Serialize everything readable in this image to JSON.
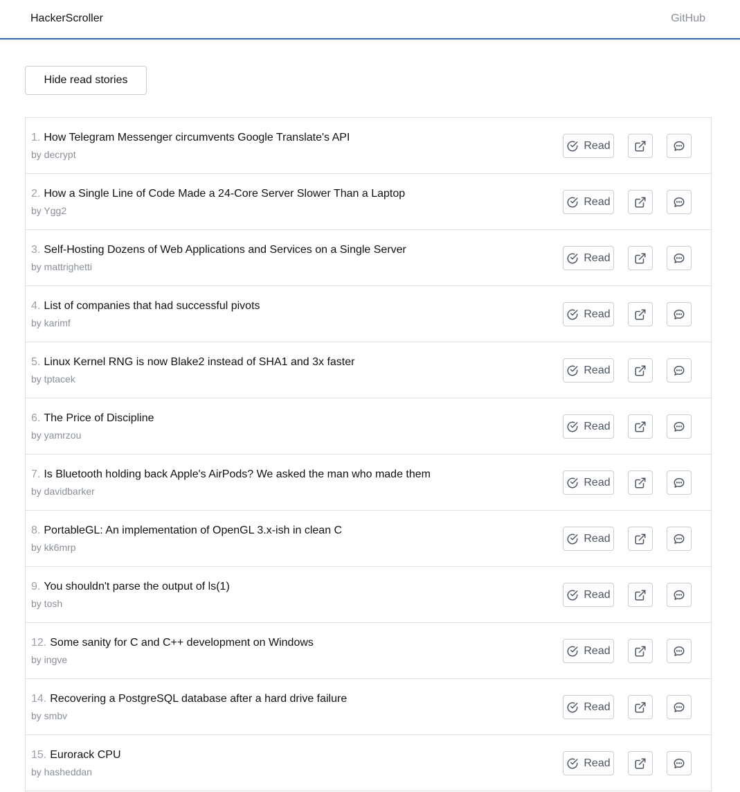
{
  "header": {
    "brand": "HackerScroller",
    "github_link": "GitHub"
  },
  "toolbar": {
    "hide_read_label": "Hide read stories"
  },
  "icons": {
    "read": "check-circle-icon",
    "open_link": "external-link-icon",
    "comments": "comment-bubble-icon"
  },
  "colors": {
    "accent": "#2b6cb0",
    "muted_text": "#8a8f98",
    "border": "#dcdfe3"
  },
  "stories": [
    {
      "rank": "1.",
      "title": "How Telegram Messenger circumvents Google Translate's API",
      "byline": "by decrypt",
      "read_label": "Read"
    },
    {
      "rank": "2.",
      "title": "How a Single Line of Code Made a 24-Core Server Slower Than a Laptop",
      "byline": "by Ygg2",
      "read_label": "Read"
    },
    {
      "rank": "3.",
      "title": "Self-Hosting Dozens of Web Applications and Services on a Single Server",
      "byline": "by mattrighetti",
      "read_label": "Read"
    },
    {
      "rank": "4.",
      "title": "List of companies that had successful pivots",
      "byline": "by karimf",
      "read_label": "Read"
    },
    {
      "rank": "5.",
      "title": "Linux Kernel RNG is now Blake2 instead of SHA1 and 3x faster",
      "byline": "by tptacek",
      "read_label": "Read"
    },
    {
      "rank": "6.",
      "title": "The Price of Discipline",
      "byline": "by yamrzou",
      "read_label": "Read"
    },
    {
      "rank": "7.",
      "title": "Is Bluetooth holding back Apple's AirPods? We asked the man who made them",
      "byline": "by davidbarker",
      "read_label": "Read"
    },
    {
      "rank": "8.",
      "title": "PortableGL: An implementation of OpenGL 3.x-ish in clean C",
      "byline": "by kk6mrp",
      "read_label": "Read"
    },
    {
      "rank": "9.",
      "title": "You shouldn't parse the output of ls(1)",
      "byline": "by tosh",
      "read_label": "Read"
    },
    {
      "rank": "12.",
      "title": "Some sanity for C and C++ development on Windows",
      "byline": "by ingve",
      "read_label": "Read"
    },
    {
      "rank": "14.",
      "title": "Recovering a PostgreSQL database after a hard drive failure",
      "byline": "by smbv",
      "read_label": "Read"
    },
    {
      "rank": "15.",
      "title": "Eurorack CPU",
      "byline": "by hasheddan",
      "read_label": "Read"
    }
  ]
}
